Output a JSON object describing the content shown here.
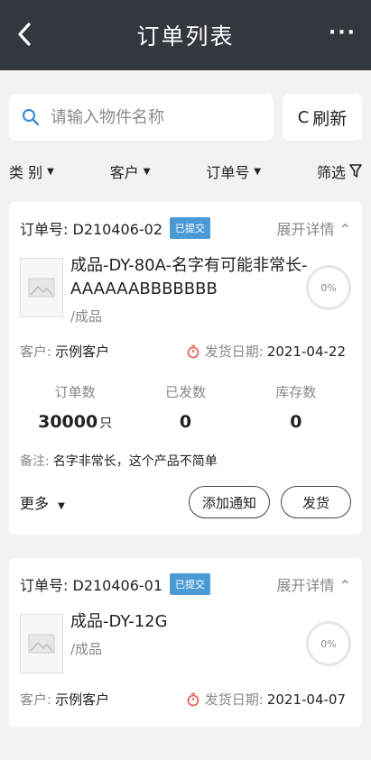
{
  "header": {
    "title": "订单列表",
    "more_label": "···"
  },
  "search": {
    "placeholder": "请输入物件名称",
    "refresh_label": "刷新"
  },
  "filters": [
    {
      "label": "类 别"
    },
    {
      "label": "客户"
    },
    {
      "label": "订单号"
    },
    {
      "label": "筛选"
    }
  ],
  "labels": {
    "order_no": "订单号:",
    "expand": "展开详情",
    "customer": "客户:",
    "ship_date": "发货日期:",
    "order_qty": "订单数",
    "shipped": "已发数",
    "stock": "库存数",
    "remark": "备注:",
    "more": "更多",
    "add_notice": "添加通知",
    "ship": "发货"
  },
  "orders": [
    {
      "order_no": "D210406-02",
      "status": "已提交",
      "product_name": "成品-DY-80A-名字有可能非常长-AAAAAABBBBBBB",
      "category": "/成品",
      "progress": "0%",
      "customer": "示例客户",
      "ship_date": "2021-04-22",
      "order_qty": "30000",
      "order_unit": "只",
      "shipped": "0",
      "stock": "0",
      "remark": "名字非常长，这个产品不简单"
    },
    {
      "order_no": "D210406-01",
      "status": "已提交",
      "product_name": "成品-DY-12G",
      "category": "/成品",
      "progress": "0%",
      "customer": "示例客户",
      "ship_date": "2021-04-07"
    }
  ]
}
